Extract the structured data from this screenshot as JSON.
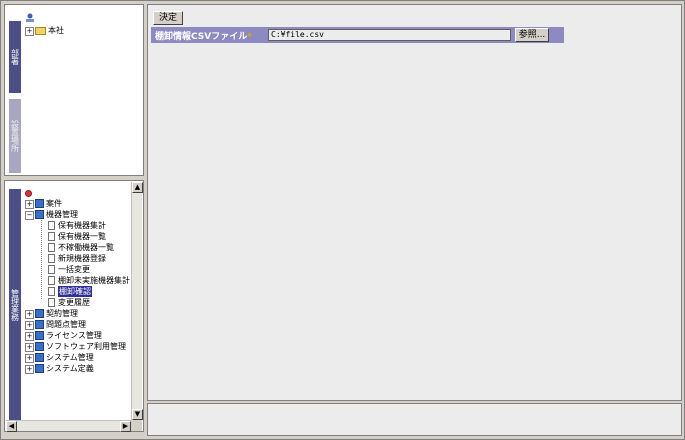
{
  "org_tree": {
    "root_label": "本社"
  },
  "tabs": {
    "department": "部署",
    "location": "設置場所",
    "management": "管理業務"
  },
  "menu_tree": {
    "items": [
      {
        "label": "案件"
      },
      {
        "label": "機器管理"
      },
      {
        "label": "保有機器集計"
      },
      {
        "label": "保有機器一覧"
      },
      {
        "label": "不稼働機器一覧"
      },
      {
        "label": "新規機器登録"
      },
      {
        "label": "一括変更"
      },
      {
        "label": "棚卸未実施機器集計"
      },
      {
        "label": "棚卸確認"
      },
      {
        "label": "変更履歴"
      },
      {
        "label": "契約管理"
      },
      {
        "label": "問題点管理"
      },
      {
        "label": "ライセンス管理"
      },
      {
        "label": "ソフトウェア利用管理"
      },
      {
        "label": "システム管理"
      },
      {
        "label": "システム定義"
      }
    ],
    "selected_index": 8
  },
  "toolbar": {
    "decide_label": "決定"
  },
  "csv_form": {
    "label": "棚卸情報CSVファイル",
    "required_mark": "*",
    "value": "C:¥file.csv",
    "browse_label": "参照..."
  },
  "colors": {
    "active_tab": "#4b4f86",
    "form_row": "#8d8ac2",
    "selection": "#2f2f96"
  }
}
